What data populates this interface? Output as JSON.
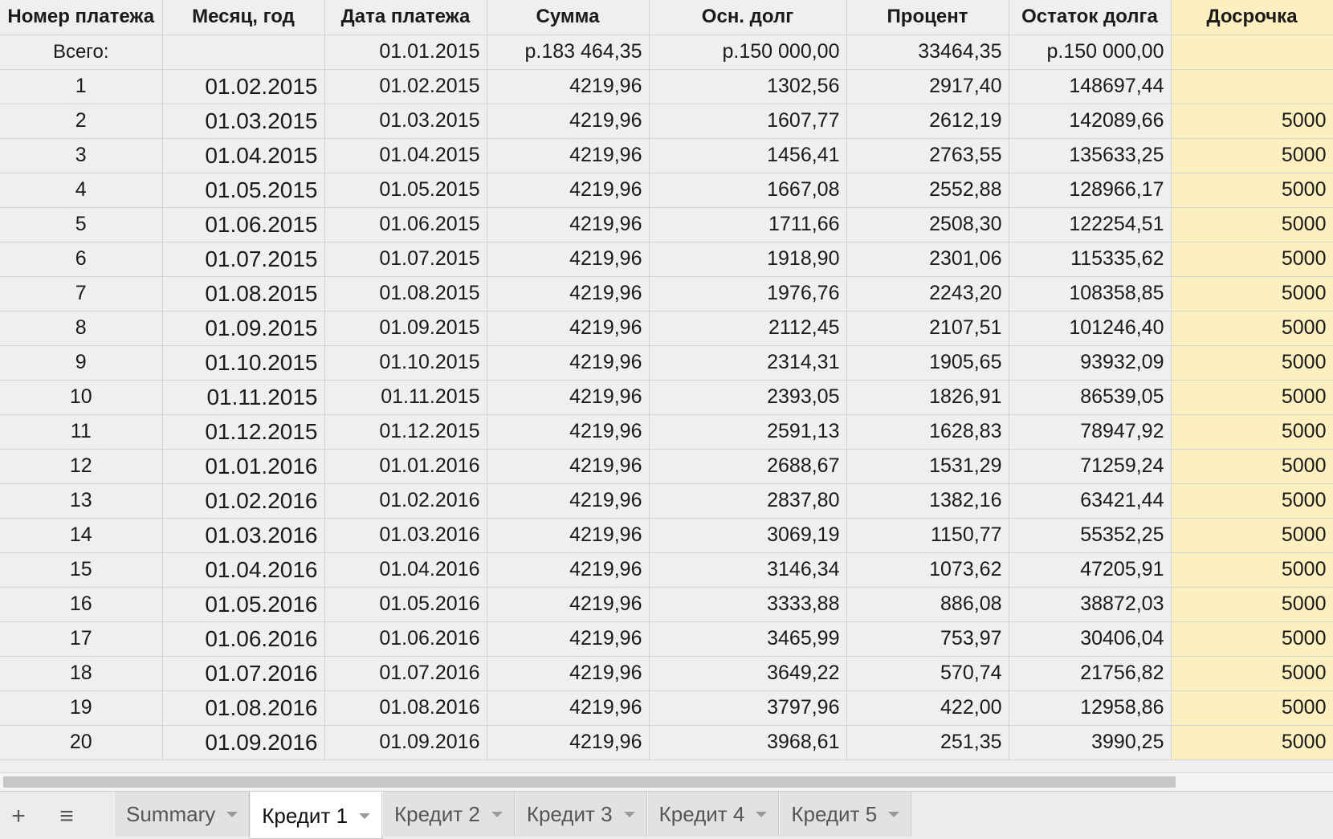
{
  "columns": [
    "Номер платежа",
    "Месяц, год",
    "Дата платежа",
    "Сумма",
    "Осн. долг",
    "Процент",
    "Остаток долга",
    "Досрочка"
  ],
  "total_row": [
    "Всего:",
    "",
    "01.01.2015",
    "р.183 464,35",
    "р.150 000,00",
    "33464,35",
    "р.150 000,00",
    ""
  ],
  "rows": [
    [
      "1",
      "01.02.2015",
      "01.02.2015",
      "4219,96",
      "1302,56",
      "2917,40",
      "148697,44",
      ""
    ],
    [
      "2",
      "01.03.2015",
      "01.03.2015",
      "4219,96",
      "1607,77",
      "2612,19",
      "142089,66",
      "5000"
    ],
    [
      "3",
      "01.04.2015",
      "01.04.2015",
      "4219,96",
      "1456,41",
      "2763,55",
      "135633,25",
      "5000"
    ],
    [
      "4",
      "01.05.2015",
      "01.05.2015",
      "4219,96",
      "1667,08",
      "2552,88",
      "128966,17",
      "5000"
    ],
    [
      "5",
      "01.06.2015",
      "01.06.2015",
      "4219,96",
      "1711,66",
      "2508,30",
      "122254,51",
      "5000"
    ],
    [
      "6",
      "01.07.2015",
      "01.07.2015",
      "4219,96",
      "1918,90",
      "2301,06",
      "115335,62",
      "5000"
    ],
    [
      "7",
      "01.08.2015",
      "01.08.2015",
      "4219,96",
      "1976,76",
      "2243,20",
      "108358,85",
      "5000"
    ],
    [
      "8",
      "01.09.2015",
      "01.09.2015",
      "4219,96",
      "2112,45",
      "2107,51",
      "101246,40",
      "5000"
    ],
    [
      "9",
      "01.10.2015",
      "01.10.2015",
      "4219,96",
      "2314,31",
      "1905,65",
      "93932,09",
      "5000"
    ],
    [
      "10",
      "01.11.2015",
      "01.11.2015",
      "4219,96",
      "2393,05",
      "1826,91",
      "86539,05",
      "5000"
    ],
    [
      "11",
      "01.12.2015",
      "01.12.2015",
      "4219,96",
      "2591,13",
      "1628,83",
      "78947,92",
      "5000"
    ],
    [
      "12",
      "01.01.2016",
      "01.01.2016",
      "4219,96",
      "2688,67",
      "1531,29",
      "71259,24",
      "5000"
    ],
    [
      "13",
      "01.02.2016",
      "01.02.2016",
      "4219,96",
      "2837,80",
      "1382,16",
      "63421,44",
      "5000"
    ],
    [
      "14",
      "01.03.2016",
      "01.03.2016",
      "4219,96",
      "3069,19",
      "1150,77",
      "55352,25",
      "5000"
    ],
    [
      "15",
      "01.04.2016",
      "01.04.2016",
      "4219,96",
      "3146,34",
      "1073,62",
      "47205,91",
      "5000"
    ],
    [
      "16",
      "01.05.2016",
      "01.05.2016",
      "4219,96",
      "3333,88",
      "886,08",
      "38872,03",
      "5000"
    ],
    [
      "17",
      "01.06.2016",
      "01.06.2016",
      "4219,96",
      "3465,99",
      "753,97",
      "30406,04",
      "5000"
    ],
    [
      "18",
      "01.07.2016",
      "01.07.2016",
      "4219,96",
      "3649,22",
      "570,74",
      "21756,82",
      "5000"
    ],
    [
      "19",
      "01.08.2016",
      "01.08.2016",
      "4219,96",
      "3797,96",
      "422,00",
      "12958,86",
      "5000"
    ],
    [
      "20",
      "01.09.2016",
      "01.09.2016",
      "4219,96",
      "3968,61",
      "251,35",
      "3990,25",
      "5000"
    ]
  ],
  "sheet_tabs": [
    "Summary",
    "Кредит 1",
    "Кредит 2",
    "Кредит 3",
    "Кредит 4",
    "Кредит 5"
  ],
  "active_tab": "Кредит 1",
  "icons": {
    "add_sheet": "plus-icon",
    "all_sheets": "menu-icon",
    "tab_menu": "caret-down-icon"
  },
  "colors": {
    "highlight_column": "#fcefc0",
    "cell_bg": "#efefef",
    "grid_line": "#d2d2d2"
  }
}
